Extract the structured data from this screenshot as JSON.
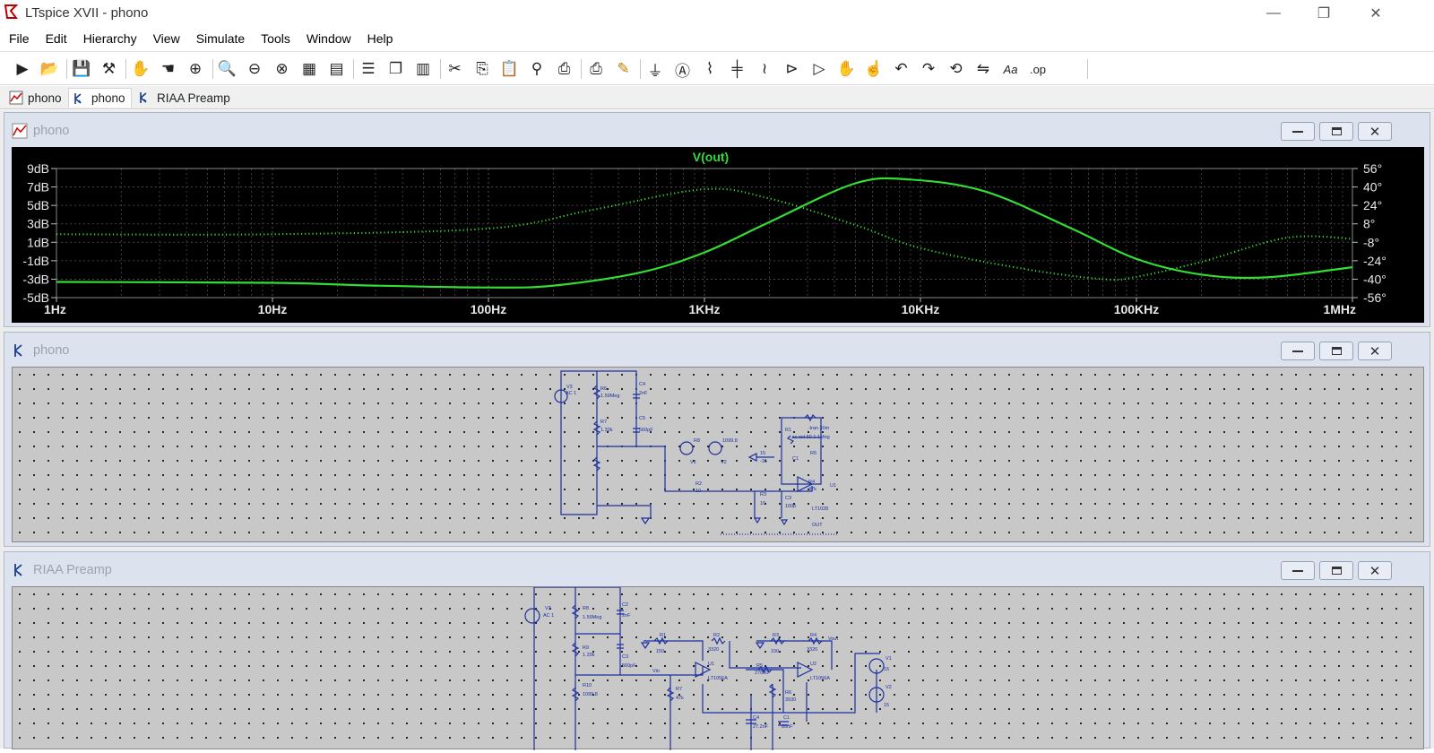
{
  "app": {
    "title": "LTspice XVII - phono"
  },
  "menu": [
    "File",
    "Edit",
    "Hierarchy",
    "View",
    "Simulate",
    "Tools",
    "Window",
    "Help"
  ],
  "toolbar_icons": [
    "run-icon",
    "open-icon",
    "save-icon",
    "control-panel-icon",
    "halt-icon",
    "pan-icon",
    "zoom-in-icon",
    "zoom-area-icon",
    "zoom-out-icon",
    "zoom-cancel-icon",
    "autorange-icon",
    "plot-settings-icon",
    "tile-horizontal-icon",
    "cascade-icon",
    "tile-vertical-icon",
    "cut-icon",
    "copy-icon",
    "paste-icon",
    "find-icon",
    "print-icon",
    "print-preview-icon",
    "draw-wire-icon",
    "ground-icon",
    "net-label-icon",
    "resistor-icon",
    "capacitor-icon",
    "inductor-icon",
    "diode-icon",
    "component-icon",
    "move-icon",
    "drag-icon",
    "undo-icon",
    "redo-icon",
    "rotate-icon",
    "mirror-icon",
    "text-icon",
    "spice-directive-icon"
  ],
  "tabs": [
    {
      "label": "phono",
      "icon": "waveform-icon"
    },
    {
      "label": "phono",
      "icon": "schematic-icon"
    },
    {
      "label": "RIAA Preamp",
      "icon": "schematic-icon"
    }
  ],
  "windows": {
    "plot": {
      "title": "phono"
    },
    "schematic1": {
      "title": "phono"
    },
    "schematic2": {
      "title": "RIAA Preamp"
    }
  },
  "chart_data": {
    "type": "line",
    "title": "V(out)",
    "xscale": "log",
    "x_ticks": [
      "1Hz",
      "10Hz",
      "100Hz",
      "1KHz",
      "10KHz",
      "100KHz",
      "1MHz"
    ],
    "y_left_ticks": [
      "9dB",
      "7dB",
      "5dB",
      "3dB",
      "1dB",
      "-1dB",
      "-3dB",
      "-5dB"
    ],
    "y_right_ticks": [
      "56°",
      "40°",
      "24°",
      "8°",
      "-8°",
      "-24°",
      "-40°",
      "-56°"
    ],
    "ylim_left": [
      -5,
      9
    ],
    "ylim_right": [
      -56,
      56
    ],
    "grid": true,
    "color": "#33dd33",
    "series": [
      {
        "name": "magnitude",
        "style": "solid",
        "axis": "left",
        "x": [
          1,
          10,
          30,
          100,
          200,
          500,
          1000,
          2000,
          5000,
          9000,
          20000,
          50000,
          100000,
          200000,
          400000,
          1000000
        ],
        "y": [
          -3.3,
          -3.4,
          -3.7,
          -3.9,
          -3.7,
          -2.3,
          -0.1,
          3.2,
          7.4,
          7.8,
          6.5,
          2.5,
          -0.8,
          -2.5,
          -2.8,
          -1.7
        ]
      },
      {
        "name": "phase",
        "style": "dotted",
        "axis": "right",
        "x": [
          1,
          10,
          100,
          300,
          1000,
          2000,
          5000,
          10000,
          30000,
          70000,
          100000,
          200000,
          500000,
          1000000
        ],
        "y": [
          -1,
          -1,
          4,
          20,
          38,
          30,
          7,
          -13,
          -31,
          -40,
          -38,
          -25,
          -4,
          -5
        ]
      }
    ]
  },
  "schematic1": {
    "labels": [
      "V3",
      "AC 1",
      "R6",
      "1.59Meg",
      "C4",
      "2nF",
      "R7",
      "1.33k",
      "C5",
      "560pF",
      "R8",
      "1099.8",
      "V1",
      "V2",
      "15",
      "-15",
      "R2",
      "10",
      "R3",
      "10",
      "C3",
      "100p",
      "R4",
      "47k",
      "U1",
      "LT1028",
      "OUT",
      ".ac oct 50 1 1Meg",
      ".tran 30m",
      "R1",
      "R5",
      "C1",
      "C2"
    ]
  },
  "schematic2": {
    "labels": [
      "V3",
      "AC 1",
      "R8",
      "1.59Meg",
      "C2",
      "2nF",
      "C3",
      "560pF",
      "R9",
      "1.33k",
      "R10",
      "1099.8",
      "R1",
      "150",
      "R2",
      "3320",
      "R3",
      "100",
      "R4",
      "3320",
      "Vout",
      "Vin",
      "U1",
      "LT1056A",
      "U2",
      "LT1056A",
      "R5",
      "27000",
      "R6",
      "3930",
      "R7",
      "47k",
      "C4",
      "27.2nF",
      "C1",
      "80nF",
      "V1",
      "V2",
      "15",
      "15"
    ]
  }
}
